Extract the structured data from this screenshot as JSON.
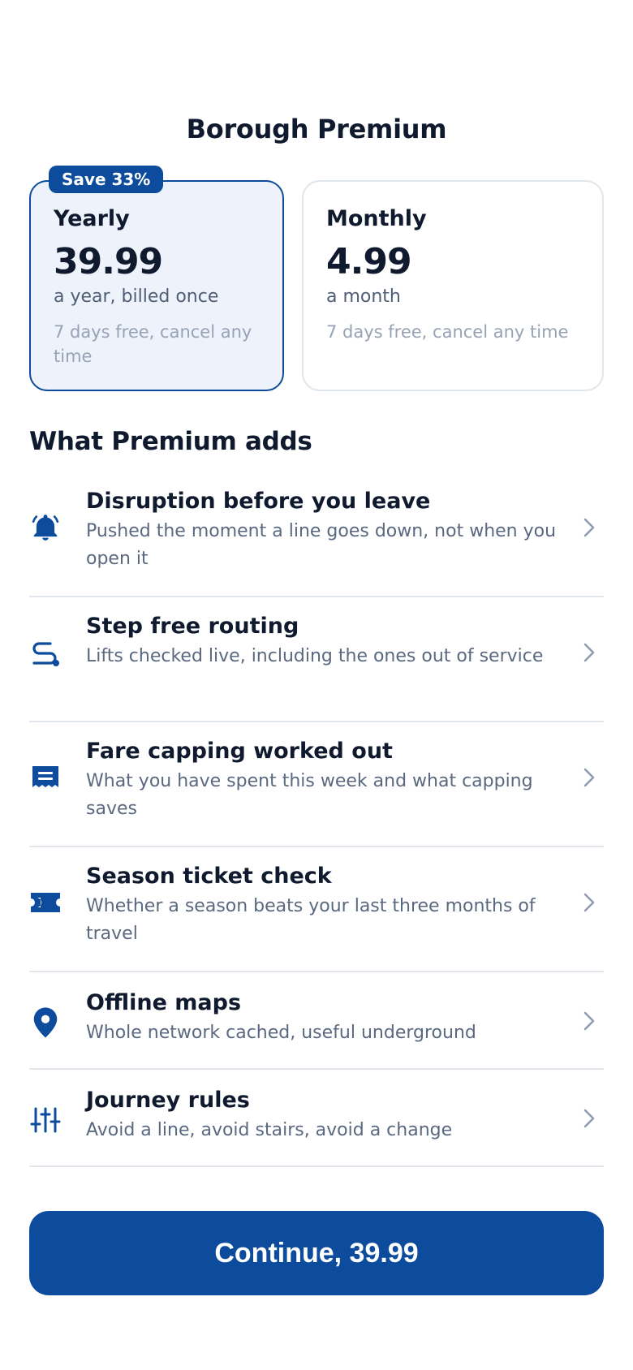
{
  "title": "Borough Premium",
  "plans": {
    "badge": "Save 33%",
    "yearly": {
      "name": "Yearly",
      "price": "39.99",
      "period": "a year, billed once",
      "trial": "7 days free, cancel any time"
    },
    "monthly": {
      "name": "Monthly",
      "price": "4.99",
      "period": "a month",
      "trial": "7 days free, cancel any time"
    },
    "selected": "yearly"
  },
  "section_title": "What Premium adds",
  "features": [
    {
      "icon": "bell-icon",
      "title": "Disruption before you leave",
      "desc": "Pushed the moment a line goes down, not when you open it"
    },
    {
      "icon": "route-icon",
      "title": "Step free routing",
      "desc": "Lifts checked live, including the ones out of service"
    },
    {
      "icon": "receipt-icon",
      "title": "Fare capping worked out",
      "desc": "What you have spent this week and what capping saves"
    },
    {
      "icon": "ticket-icon",
      "title": "Season ticket check",
      "desc": "Whether a season beats your last three months of travel"
    },
    {
      "icon": "map-pin-icon",
      "title": "Offline maps",
      "desc": "Whole network cached, useful underground"
    },
    {
      "icon": "sliders-icon",
      "title": "Journey rules",
      "desc": "Avoid a line, avoid stairs, avoid a change"
    }
  ],
  "cta_label": "Continue, 39.99",
  "colors": {
    "accent": "#0d4c9c",
    "text": "#0f1a2e",
    "muted": "#5a6880",
    "faint": "#97a3b5",
    "divider": "#e2e7ee"
  }
}
